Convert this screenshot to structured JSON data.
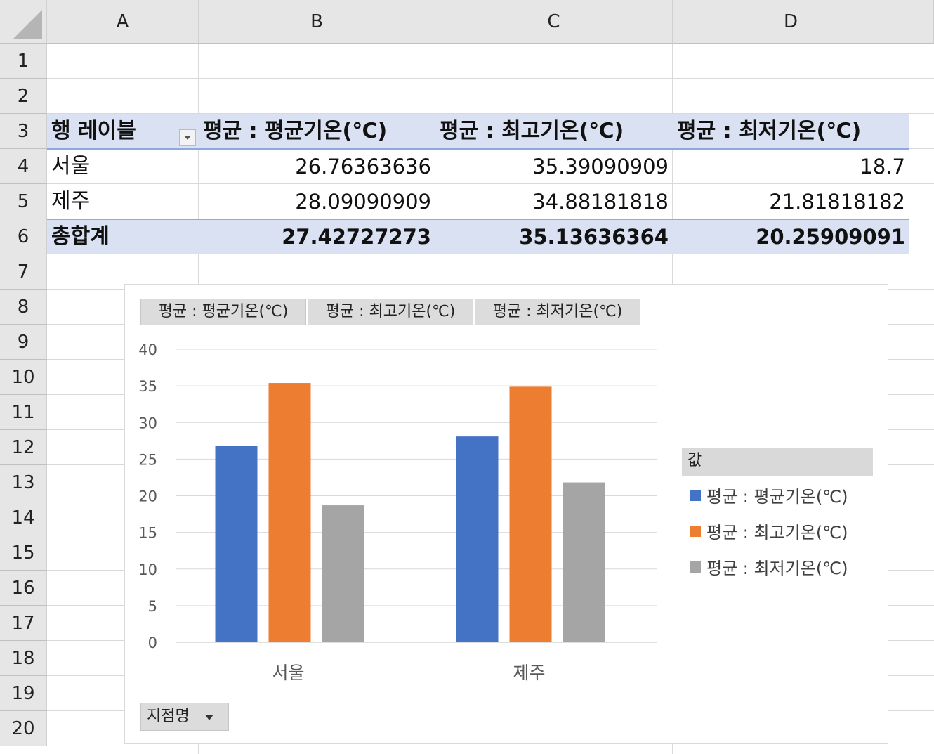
{
  "columns": [
    "A",
    "B",
    "C",
    "D"
  ],
  "rows": [
    "1",
    "2",
    "3",
    "4",
    "5",
    "6",
    "7",
    "8",
    "9",
    "10",
    "11",
    "12",
    "13",
    "14",
    "15",
    "16",
    "17",
    "18",
    "19",
    "20"
  ],
  "pivot": {
    "header": [
      "행 레이블",
      "평균 : 평균기온(℃)",
      "평균 : 최고기온(℃)",
      "평균 : 최저기온(℃)"
    ],
    "body": [
      [
        "서울",
        "26.76363636",
        "35.39090909",
        "18.7"
      ],
      [
        "제주",
        "28.09090909",
        "34.88181818",
        "21.81818182"
      ]
    ],
    "total": [
      "총합계",
      "27.42727273",
      "35.13636364",
      "20.25909091"
    ]
  },
  "chart": {
    "field_buttons": [
      "평균 : 평균기온(℃)",
      "평균 : 최고기온(℃)",
      "평균 : 최저기온(℃)"
    ],
    "legend_title": "값",
    "axis_field_button": "지점명"
  },
  "colors": {
    "series": [
      "#4472c4",
      "#ed7d31",
      "#a5a5a5"
    ],
    "pivot_band": "#d9e1f2"
  },
  "chart_data": {
    "type": "bar",
    "categories": [
      "서울",
      "제주"
    ],
    "series": [
      {
        "name": "평균 : 평균기온(℃)",
        "values": [
          26.76363636,
          28.09090909
        ]
      },
      {
        "name": "평균 : 최고기온(℃)",
        "values": [
          35.39090909,
          34.88181818
        ]
      },
      {
        "name": "평균 : 최저기온(℃)",
        "values": [
          18.7,
          21.81818182
        ]
      }
    ],
    "ylim": [
      0,
      40
    ],
    "yticks": [
      "0",
      "5",
      "10",
      "15",
      "20",
      "25",
      "30",
      "35",
      "40"
    ],
    "grid": true,
    "legend_position": "right",
    "title": "",
    "xlabel": "",
    "ylabel": ""
  }
}
